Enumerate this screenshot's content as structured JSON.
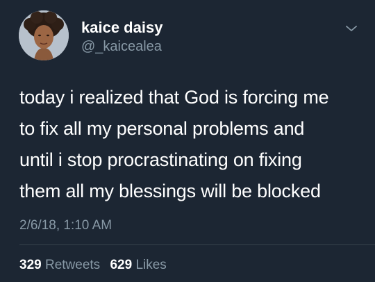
{
  "user": {
    "display_name": "kaice daisy",
    "handle": "@_kaicealea"
  },
  "tweet": {
    "lines": [
      "today i realized that God is forcing me",
      "to fix all my personal problems and",
      "until i stop procrastinating on fixing",
      "them all my blessings will be blocked"
    ],
    "timestamp": "2/6/18, 1:10 AM"
  },
  "stats": {
    "retweets_count": "329",
    "retweets_label": "Retweets",
    "likes_count": "629",
    "likes_label": "Likes"
  },
  "icons": {
    "menu": "chevron-down-icon"
  },
  "colors": {
    "background": "#1c2633",
    "secondary_text": "#8899a6",
    "primary_text": "#ffffff"
  }
}
